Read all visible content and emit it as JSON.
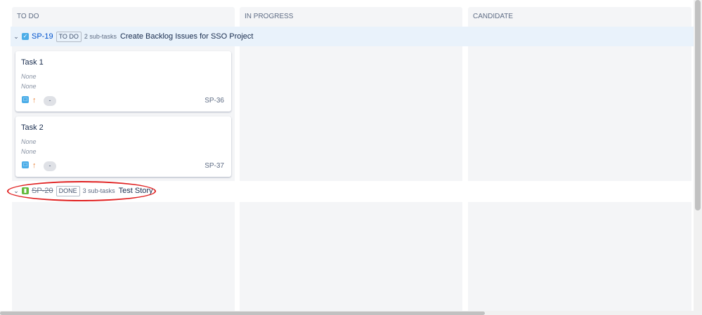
{
  "columns": [
    {
      "label": "TO DO"
    },
    {
      "label": "IN PROGRESS"
    },
    {
      "label": "CANDIDATE"
    }
  ],
  "swimlanes": [
    {
      "key": "SP-19",
      "status": "TO DO",
      "subtasks": "2 sub-tasks",
      "summary": "Create Backlog Issues for SSO Project",
      "type_icon": "task-checkbox-icon"
    },
    {
      "key": "SP-20",
      "status": "DONE",
      "subtasks": "3 sub-tasks",
      "summary": "Test Story",
      "type_icon": "story-icon"
    }
  ],
  "cards": [
    {
      "title": "Task 1",
      "field1": "None",
      "field2": "None",
      "key": "SP-36",
      "avatar": "-"
    },
    {
      "title": "Task 2",
      "field1": "None",
      "field2": "None",
      "key": "SP-37",
      "avatar": "-"
    }
  ],
  "colors": {
    "accent": "#0052cc",
    "highlight": "#e9f2fb",
    "annotation": "#e02020",
    "priority": "#e97f33"
  }
}
